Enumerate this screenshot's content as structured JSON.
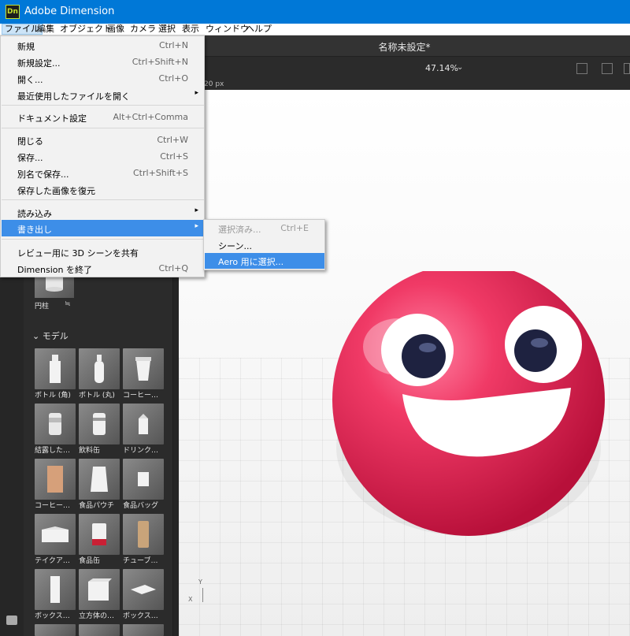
{
  "window": {
    "app_logo": "Dn",
    "title": "Adobe Dimension"
  },
  "menubar": {
    "items": [
      "ファイル",
      "編集",
      "オブジェクト",
      "画像",
      "カメラ",
      "選択",
      "表示",
      "ウィンドウ",
      "ヘルプ"
    ]
  },
  "document": {
    "title": "名称未設定*",
    "zoom": "47.14%",
    "ruler_text": "20 px"
  },
  "file_menu": {
    "items": [
      {
        "label": "新規",
        "shortcut": "Ctrl+N"
      },
      {
        "label": "新規設定...",
        "shortcut": "Ctrl+Shift+N"
      },
      {
        "label": "開く...",
        "shortcut": "Ctrl+O"
      },
      {
        "label": "最近使用したファイルを開く",
        "shortcut": ""
      },
      {
        "label": "ドキュメント設定",
        "shortcut": "Alt+Ctrl+Comma"
      },
      {
        "label": "閉じる",
        "shortcut": "Ctrl+W"
      },
      {
        "label": "保存...",
        "shortcut": "Ctrl+S"
      },
      {
        "label": "別名で保存...",
        "shortcut": "Ctrl+Shift+S"
      },
      {
        "label": "保存した画像を復元",
        "shortcut": ""
      },
      {
        "label": "読み込み",
        "shortcut": ""
      },
      {
        "label": "書き出し",
        "shortcut": ""
      },
      {
        "label": "レビュー用に 3D シーンを共有",
        "shortcut": ""
      },
      {
        "label": "Dimension を終了",
        "shortcut": "Ctrl+Q"
      }
    ]
  },
  "export_submenu": {
    "items": [
      {
        "label": "選択済み...",
        "shortcut": "Ctrl+E"
      },
      {
        "label": "シーン...",
        "shortcut": ""
      },
      {
        "label": "Aero 用に選択...",
        "shortcut": ""
      }
    ]
  },
  "assets": {
    "cylinder_label": "円柱",
    "section_title": "モデル",
    "models": [
      {
        "label": "ボトル (角)",
        "icon": "square-bottle"
      },
      {
        "label": "ボトル (丸)",
        "icon": "round-bottle"
      },
      {
        "label": "コーヒー…",
        "icon": "coffee-cup"
      },
      {
        "label": "結露した…",
        "icon": "wet-can"
      },
      {
        "label": "飲料缶",
        "icon": "beverage-can"
      },
      {
        "label": "ドリンク…",
        "icon": "drink-carton"
      },
      {
        "label": "コーヒー…",
        "icon": "coffee-bag"
      },
      {
        "label": "食品パウチ",
        "icon": "food-pouch"
      },
      {
        "label": "食品バッグ",
        "icon": "food-bag"
      },
      {
        "label": "テイクア…",
        "icon": "takeout-box"
      },
      {
        "label": "食品缶",
        "icon": "food-can"
      },
      {
        "label": "チューブ…",
        "icon": "tube"
      },
      {
        "label": "ボックス…",
        "icon": "tall-box"
      },
      {
        "label": "立方体の…",
        "icon": "cube-box"
      },
      {
        "label": "ボックス…",
        "icon": "flat-box"
      }
    ]
  },
  "colors": {
    "accent": "#3d8ee8",
    "titlebar": "#0078d7",
    "sphere": "#ee2858"
  }
}
